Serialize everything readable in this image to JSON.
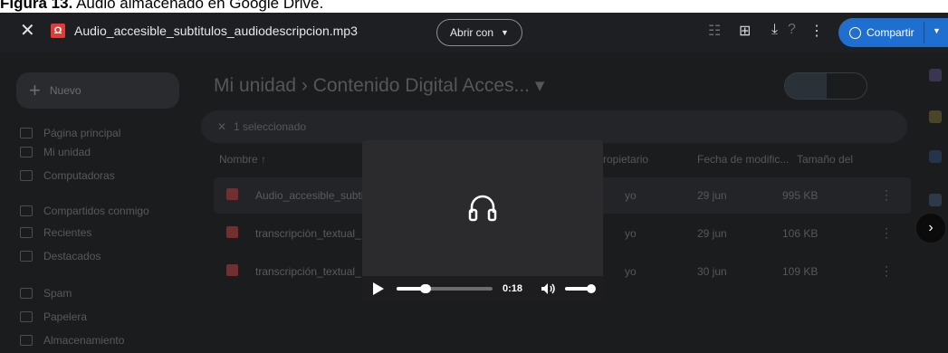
{
  "caption": {
    "label": "Figura 13.",
    "text": " Audio almacenado en Google Drive."
  },
  "topbar": {
    "file_icon_letter": "Ω",
    "file_name": "Audio_accesible_subtitulos_audiodescripcion.mp3",
    "open_with_label": "Abrir con",
    "share_label": "Compartir"
  },
  "drive_bg": {
    "new_button": "Nuevo",
    "breadcrumb": "Mi unidad  ›  Contenido Digital Acces... ▾",
    "selection_text": "1 seleccionado",
    "sidebar": [
      "Página principal",
      "Mi unidad",
      "Computadoras",
      "Compartidos conmigo",
      "Recientes",
      "Destacados",
      "Spam",
      "Papelera",
      "Almacenamiento"
    ],
    "columns": {
      "name": "Nombre ↑",
      "owner": "ropietario",
      "modified": "Fecha de modific...",
      "size": "Tamaño del"
    },
    "files": [
      {
        "name": "Audio_accesible_subti",
        "owner": "yo",
        "date": "29 jun",
        "size": "995 KB"
      },
      {
        "name": "transcripción_textual_",
        "owner": "yo",
        "date": "29 jun",
        "size": "106 KB"
      },
      {
        "name": "transcripción_textual_",
        "owner": "yo",
        "date": "30 jun",
        "size": "109 KB"
      }
    ]
  },
  "player": {
    "current_time": "0:18",
    "progress_fraction": 0.3,
    "volume_fraction": 1.0
  },
  "colors": {
    "share_blue": "#1f6fd1",
    "pdf_red": "#e53935",
    "background": "#1b1c1e"
  }
}
